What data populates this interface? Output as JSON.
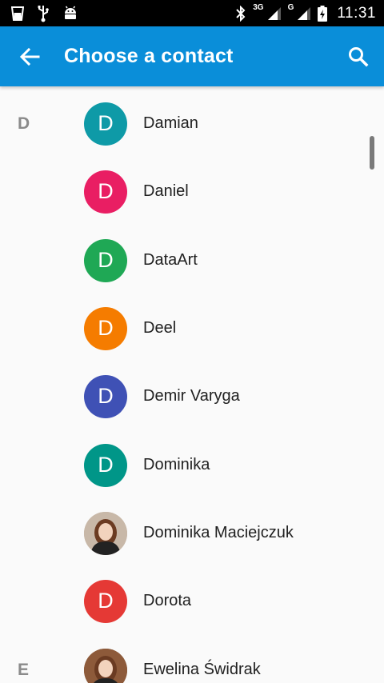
{
  "status_bar": {
    "time": "11:31",
    "net1": "3G",
    "net2": "G",
    "icons": [
      "glass-icon",
      "usb-icon",
      "android-icon",
      "bluetooth-icon",
      "signal-icon",
      "signal-icon",
      "battery-charging-icon"
    ]
  },
  "app_bar": {
    "title": "Choose a contact",
    "color": "#0a8ed9"
  },
  "contacts": [
    {
      "section": "D",
      "name": "Damian",
      "initial": "D",
      "color": "#0e9aa7",
      "photo": false
    },
    {
      "section": "",
      "name": "Daniel",
      "initial": "D",
      "color": "#e91e63",
      "photo": false
    },
    {
      "section": "",
      "name": "DataArt",
      "initial": "D",
      "color": "#1fa855",
      "photo": false
    },
    {
      "section": "",
      "name": "Deel",
      "initial": "D",
      "color": "#f57c00",
      "photo": false
    },
    {
      "section": "",
      "name": "Demir Varyga",
      "initial": "D",
      "color": "#3f51b5",
      "photo": false
    },
    {
      "section": "",
      "name": "Dominika",
      "initial": "D",
      "color": "#009688",
      "photo": false
    },
    {
      "section": "",
      "name": "Dominika Maciejczuk",
      "initial": "",
      "color": "#c8b8a8",
      "photo": true
    },
    {
      "section": "",
      "name": "Dorota",
      "initial": "D",
      "color": "#e53935",
      "photo": false
    },
    {
      "section": "E",
      "name": "Ewelina Świdrak",
      "initial": "",
      "color": "#8d5a3a",
      "photo": true
    }
  ]
}
